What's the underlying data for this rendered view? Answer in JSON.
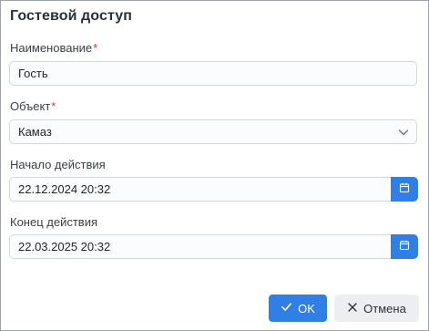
{
  "dialog": {
    "title": "Гостевой доступ"
  },
  "fields": {
    "name": {
      "label": "Наименование",
      "required_mark": "*",
      "value": "Гость"
    },
    "object": {
      "label": "Объект",
      "required_mark": "*",
      "value": "Камаз",
      "icon": "chevron-down-icon"
    },
    "start": {
      "label": "Начало действия",
      "value": "22.12.2024 20:32",
      "icon": "calendar-icon"
    },
    "end": {
      "label": "Конец действия",
      "value": "22.03.2025 20:32",
      "icon": "calendar-icon"
    }
  },
  "buttons": {
    "ok_label": "OK",
    "ok_icon": "check-icon",
    "cancel_label": "Отмена",
    "cancel_icon": "close-icon"
  },
  "colors": {
    "accent": "#2f7fe6",
    "required": "#d9383e"
  }
}
